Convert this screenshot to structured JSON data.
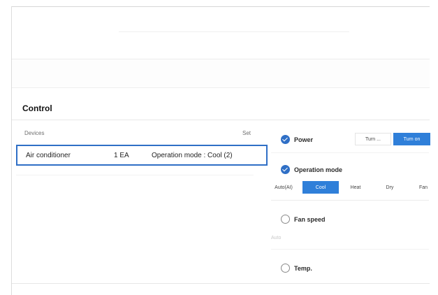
{
  "section": {
    "title": "Control"
  },
  "devices_table": {
    "header_devices": "Devices",
    "header_set": "Set",
    "rows": [
      {
        "name": "Air conditioner",
        "count": "1 EA",
        "mode": "Operation mode : Cool (2)"
      }
    ]
  },
  "controls": {
    "power": {
      "label": "Power",
      "checked": true,
      "buttons": [
        {
          "label": "Turn ...",
          "active": false
        },
        {
          "label": "Turn on",
          "active": true
        }
      ]
    },
    "operation_mode": {
      "label": "Operation mode",
      "checked": true,
      "options": [
        {
          "label": "Auto(AI)",
          "active": false
        },
        {
          "label": "Cool",
          "active": true
        },
        {
          "label": "Heat",
          "active": false
        },
        {
          "label": "Dry",
          "active": false
        },
        {
          "label": "Fan",
          "active": false
        }
      ]
    },
    "fan_speed": {
      "label": "Fan speed",
      "checked": false,
      "hint": "Auto"
    },
    "temp": {
      "label": "Temp.",
      "checked": false
    }
  },
  "colors": {
    "accent": "#2f7fd9",
    "selection_border": "#2f6fc6"
  }
}
